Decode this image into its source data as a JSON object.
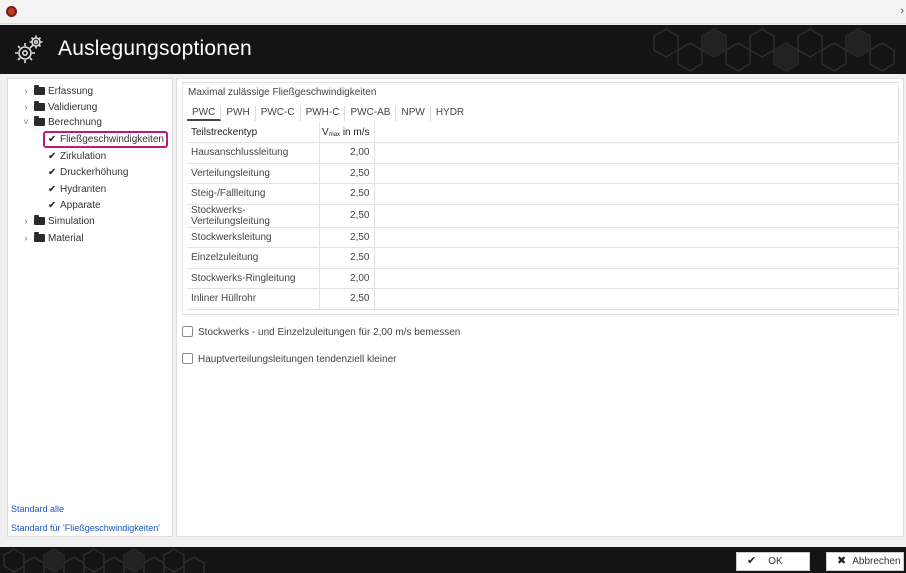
{
  "window": {
    "close_glyph": "›"
  },
  "header": {
    "title": "Auslegungsoptionen",
    "icon": "gears-icon"
  },
  "sidebar": {
    "items": [
      {
        "label": "Erfassung",
        "chevron": "›"
      },
      {
        "label": "Validierung",
        "chevron": "›"
      },
      {
        "label": "Berechnung",
        "chevron": "˅"
      },
      {
        "label": "Fließgeschwindigkeiten",
        "check": "✔"
      },
      {
        "label": "Zirkulation",
        "check": "✔"
      },
      {
        "label": "Druckerhöhung",
        "check": "✔"
      },
      {
        "label": "Hydranten",
        "check": "✔"
      },
      {
        "label": "Apparate",
        "check": "✔"
      },
      {
        "label": "Simulation",
        "chevron": "›"
      },
      {
        "label": "Material",
        "chevron": "›"
      }
    ],
    "link_default_all": "Standard alle",
    "link_default_current": "Standard für 'Fließgeschwindigkeiten'"
  },
  "panel": {
    "caption": "Maximal zulässige Fließgeschwindigkeiten",
    "tabs": [
      "PWC",
      "PWH",
      "PWC-C",
      "PWH-C",
      "PWC-AB",
      "NPW",
      "HYDR"
    ],
    "active_tab": "PWC",
    "col_type": "Teilstreckentyp",
    "col_v_main": "V",
    "col_v_sub": "max",
    "col_v_unit": "in m/s",
    "rows": [
      {
        "type": "Hausanschlussleitung",
        "vmax": "2,00"
      },
      {
        "type": "Verteilungsleitung",
        "vmax": "2,50"
      },
      {
        "type": "Steig-/Fallleitung",
        "vmax": "2,50"
      },
      {
        "type": "Stockwerks-Verteilungsleitung",
        "vmax": "2,50"
      },
      {
        "type": "Stockwerksleitung",
        "vmax": "2,50"
      },
      {
        "type": "Einzelzuleitung",
        "vmax": "2,50"
      },
      {
        "type": "Stockwerks-Ringleitung",
        "vmax": "2,00"
      },
      {
        "type": "Inliner Hüllrohr",
        "vmax": "2,50"
      }
    ]
  },
  "options": {
    "opt1": "Stockwerks - und Einzelzuleitungen für 2,00 m/s bemessen",
    "opt2": "Hauptverteilungsleitungen tendenziell kleiner",
    "opt1_checked": false,
    "opt2_checked": false
  },
  "footer": {
    "ok_label": "OK",
    "ok_icon": "✔",
    "cancel_label": "Abbrechen",
    "cancel_icon": "✖"
  },
  "colors": {
    "header_bg": "#141414",
    "selection_border": "#c0187a",
    "link": "#1a56b8"
  }
}
